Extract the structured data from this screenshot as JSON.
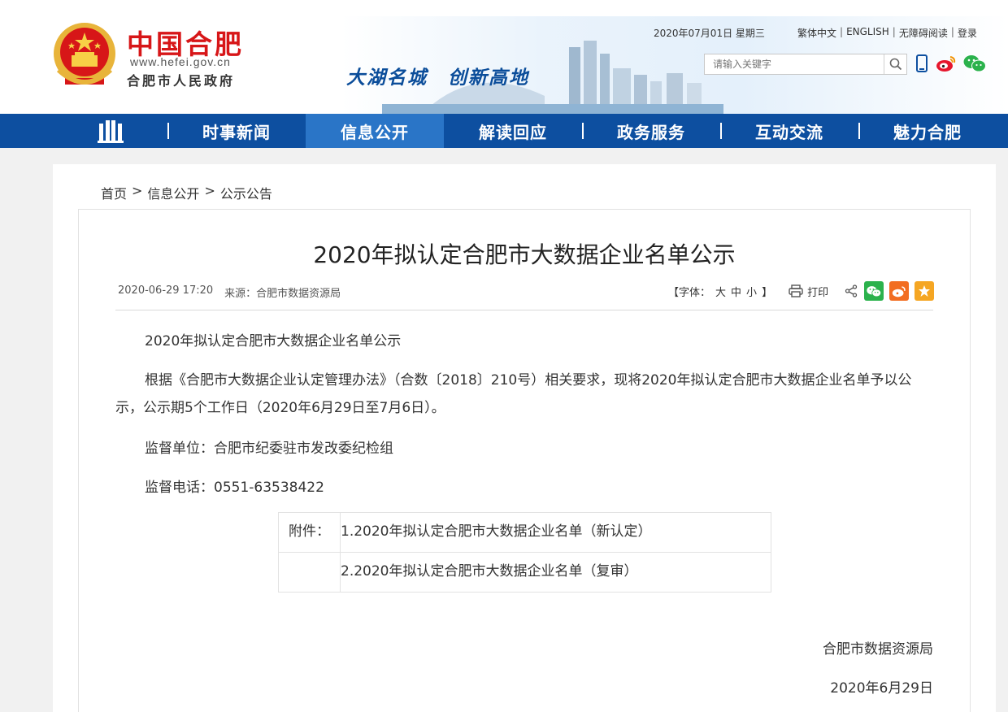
{
  "header": {
    "logo_title": "中国合肥",
    "logo_url": "www.hefei.gov.cn",
    "logo_sub": "合肥市人民政府",
    "slogan": "大湖名城　创新高地",
    "date": "2020年07月01日 星期三",
    "links": [
      "繁体中文",
      "ENGLISH",
      "无障碍阅读",
      "登录"
    ],
    "search_placeholder": "请输入关键字"
  },
  "nav": {
    "items": [
      "时事新闻",
      "信息公开",
      "解读回应",
      "政务服务",
      "互动交流",
      "魅力合肥"
    ],
    "active": "信息公开"
  },
  "breadcrumb": [
    "首页",
    "信息公开",
    "公示公告"
  ],
  "breadcrumb_sep": ">",
  "article": {
    "title": "2020年拟认定合肥市大数据企业名单公示",
    "datetime": "2020-06-29 17:20",
    "source": "来源：合肥市数据资源局",
    "font_label": "【字体：",
    "font_sizes": [
      "大",
      "中",
      "小"
    ],
    "font_close": "】",
    "print": "打印",
    "p1": "2020年拟认定合肥市大数据企业名单公示",
    "p2": "根据《合肥市大数据企业认定管理办法》（合数〔2018〕210号）相关要求，现将2020年拟认定合肥市大数据企业名单予以公示，公示期5个工作日（2020年6月29日至7月6日）。",
    "p3": "监督单位：合肥市纪委驻市发改委纪检组",
    "p4": "监督电话：0551-63538422",
    "attach_label": "附件：",
    "attachments": [
      "1.2020年拟认定合肥市大数据企业名单（新认定）",
      "2.2020年拟认定合肥市大数据企业名单（复审）"
    ],
    "sign_org": "合肥市数据资源局",
    "sign_date": "2020年6月29日"
  },
  "colors": {
    "nav_bg": "#0d4fa0",
    "nav_active": "#2a75c7",
    "logo_red": "#d71618",
    "slogan_blue": "#0b4d9a",
    "wechat_green": "#2bb24c",
    "weibo_orange": "#f26d21",
    "fav_orange": "#f5a623"
  }
}
